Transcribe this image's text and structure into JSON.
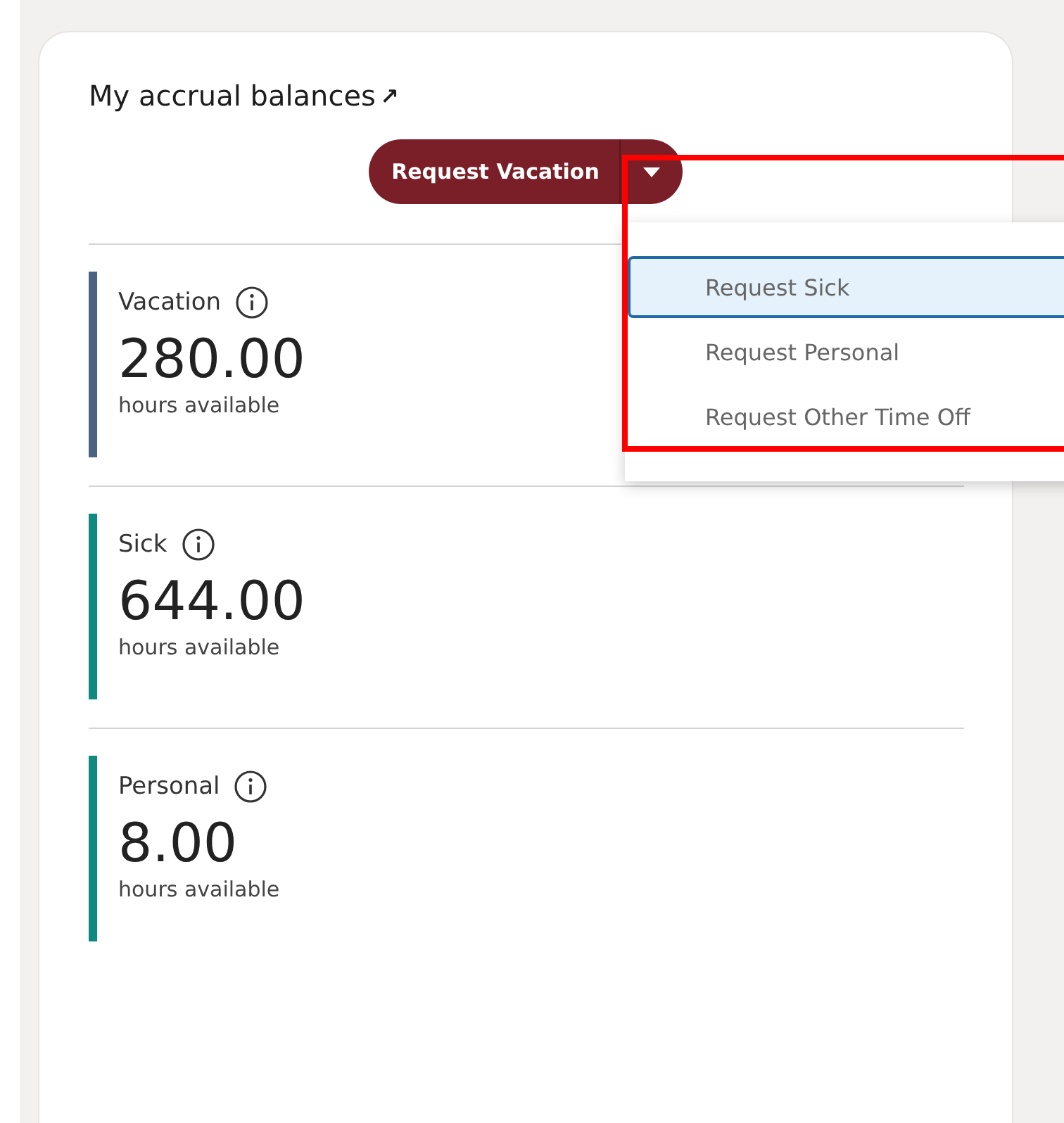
{
  "card": {
    "title": "My accrual balances",
    "title_icon": "↗"
  },
  "request_button": {
    "label": "Request Vacation"
  },
  "dropdown": {
    "items": [
      {
        "label": "Request Sick",
        "selected": true
      },
      {
        "label": "Request Personal",
        "selected": false
      },
      {
        "label": "Request Other Time Off",
        "selected": false
      }
    ]
  },
  "balances": [
    {
      "name": "Vacation",
      "value": "280.00",
      "unit": "hours available",
      "color": "#4a6380"
    },
    {
      "name": "Sick",
      "value": "644.00",
      "unit": "hours available",
      "color": "#0f8a80"
    },
    {
      "name": "Personal",
      "value": "8.00",
      "unit": "hours available",
      "color": "#0f8a80"
    }
  ]
}
